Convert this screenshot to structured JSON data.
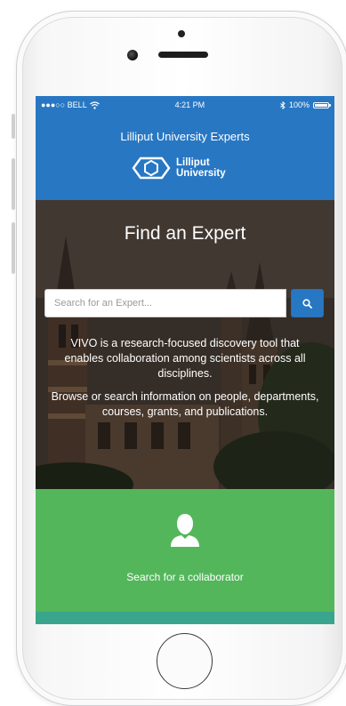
{
  "status_bar": {
    "carrier": "●●●○○ BELL",
    "time": "4:21 PM",
    "battery": "100%"
  },
  "header": {
    "title": "Lilliput University Experts",
    "logo_line1": "Lilliput",
    "logo_line2": "University"
  },
  "hero": {
    "title": "Find an Expert",
    "search_placeholder": "Search for an Expert...",
    "paragraph1": "VIVO is a research-focused discovery tool that enables collaboration among scientists across all disciplines.",
    "paragraph2": "Browse or search information on people, departments, courses, grants, and publications."
  },
  "cta": {
    "label": "Search for a collaborator",
    "icon": "person-icon"
  },
  "colors": {
    "brand_blue": "#2877c3",
    "cta_green": "#53b65b",
    "strip_teal": "#3aa58d"
  }
}
